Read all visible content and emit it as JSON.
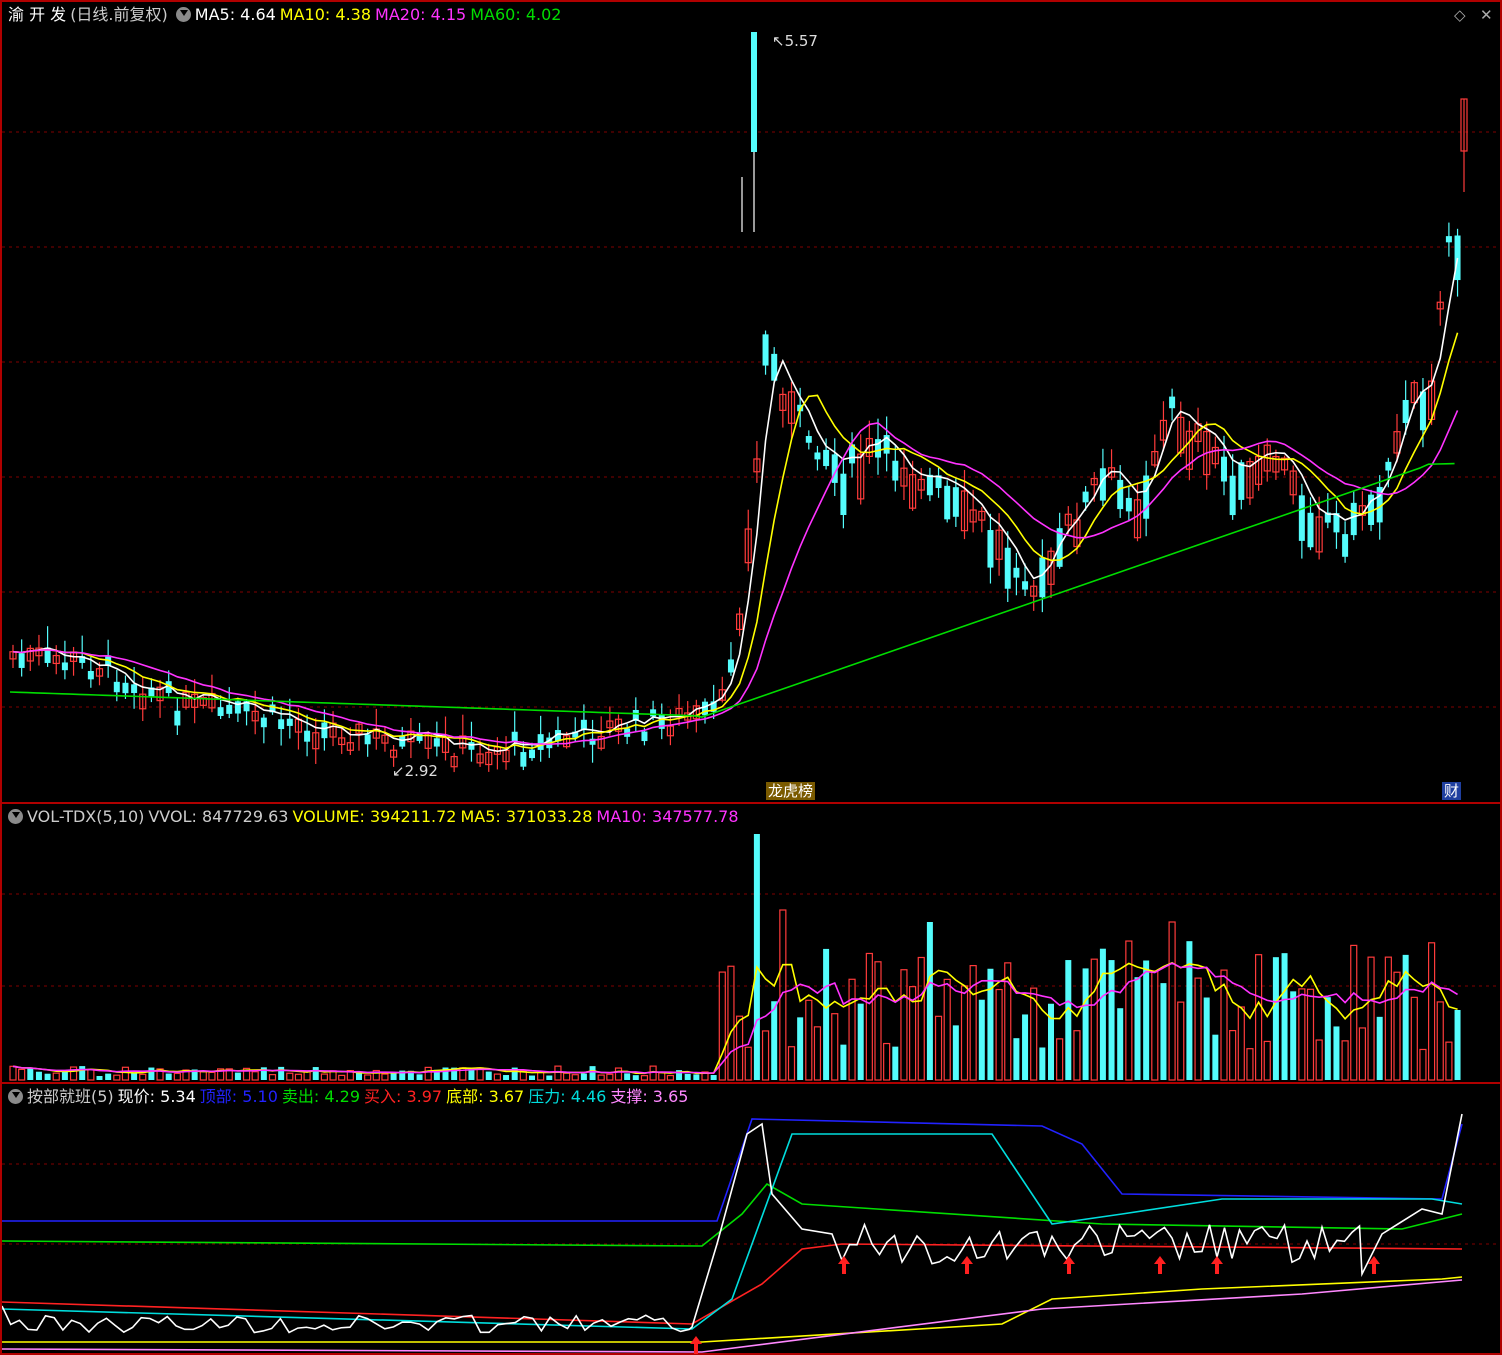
{
  "main": {
    "stock_name": "渝 开 发",
    "period": "(日线.前复权)",
    "ma_items": [
      {
        "label": "MA5:",
        "value": "4.64",
        "color": "#ffffff"
      },
      {
        "label": "MA10:",
        "value": "4.38",
        "color": "#ffff00"
      },
      {
        "label": "MA20:",
        "value": "4.15",
        "color": "#ff33ff"
      },
      {
        "label": "MA60:",
        "value": "4.02",
        "color": "#00dd00"
      }
    ],
    "high_label": "5.57",
    "low_label": "2.92",
    "tag_left": "龙虎榜",
    "tag_right": "财"
  },
  "volume": {
    "name": "VOL-TDX(5,10)",
    "items": [
      {
        "label": "VVOL:",
        "value": "847729.63",
        "color": "#cccccc"
      },
      {
        "label": "VOLUME:",
        "value": "394211.72",
        "color": "#ffff00"
      },
      {
        "label": "MA5:",
        "value": "371033.28",
        "color": "#ffff00"
      },
      {
        "label": "MA10:",
        "value": "347577.78",
        "color": "#ff33ff"
      }
    ]
  },
  "indicator": {
    "name": "按部就班(5)",
    "items": [
      {
        "label": "现价:",
        "value": "5.34",
        "color": "#ffffff"
      },
      {
        "label": "顶部:",
        "value": "5.10",
        "color": "#2222ff"
      },
      {
        "label": "卖出:",
        "value": "4.29",
        "color": "#00dd00"
      },
      {
        "label": "买入:",
        "value": "3.97",
        "color": "#ff2222"
      },
      {
        "label": "底部:",
        "value": "3.67",
        "color": "#ffff00"
      },
      {
        "label": "压力:",
        "value": "4.46",
        "color": "#00dddd"
      },
      {
        "label": "支撑:",
        "value": "3.65",
        "color": "#ff88ff"
      }
    ]
  },
  "colors": {
    "up": "#ff3b3b",
    "down": "#54fcfc",
    "grid": "#800000",
    "frame": "#b00000"
  },
  "chart_data": {
    "type": "candlestick",
    "price_range": [
      2.92,
      5.57
    ],
    "candle_count": 168
  }
}
